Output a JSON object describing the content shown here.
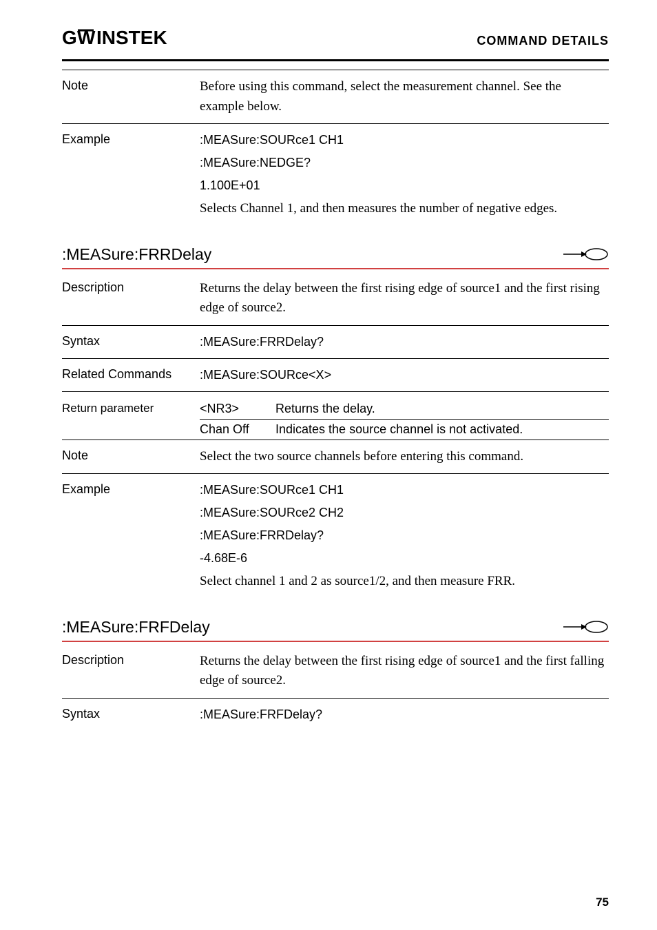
{
  "header": {
    "logo": "G℆INSTEK",
    "section": "COMMAND DETAILS"
  },
  "block1": {
    "note_label": "Note",
    "note_text": "Before using this command, select the measurement channel. See the example below.",
    "example_label": "Example",
    "example_line1": ":MEASure:SOURce1 CH1",
    "example_line2": ":MEASure:NEDGE?",
    "example_line3": "1.100E+01",
    "example_text": "Selects Channel 1, and then measures the number of negative edges."
  },
  "cmd1": {
    "name": ":MEASure:FRRDelay",
    "desc_label": "Description",
    "desc_text": "Returns the delay between the first rising edge of source1 and the first rising edge of source2.",
    "syntax_label": "Syntax",
    "syntax_value": ":MEASure:FRRDelay?",
    "related_label": "Related Commands",
    "related_value": ":MEASure:SOURce<X>",
    "return_label": "Return parameter",
    "return_p1_name": "<NR3>",
    "return_p1_desc": "Returns the delay.",
    "return_p2_name": "Chan Off",
    "return_p2_desc": "Indicates the source channel is not activated.",
    "note_label": "Note",
    "note_text": "Select the two source channels before entering this command.",
    "example_label": "Example",
    "example_line1": ":MEASure:SOURce1 CH1",
    "example_line2": ":MEASure:SOURce2 CH2",
    "example_line3": ":MEASure:FRRDelay?",
    "example_line4": "-4.68E-6",
    "example_text": "Select channel 1 and 2 as source1/2, and then measure FRR."
  },
  "cmd2": {
    "name": ":MEASure:FRFDelay",
    "desc_label": "Description",
    "desc_text": "Returns the delay between the first rising edge of source1 and the first falling edge of source2.",
    "syntax_label": "Syntax",
    "syntax_value": ":MEASure:FRFDelay?"
  },
  "page_number": "75"
}
